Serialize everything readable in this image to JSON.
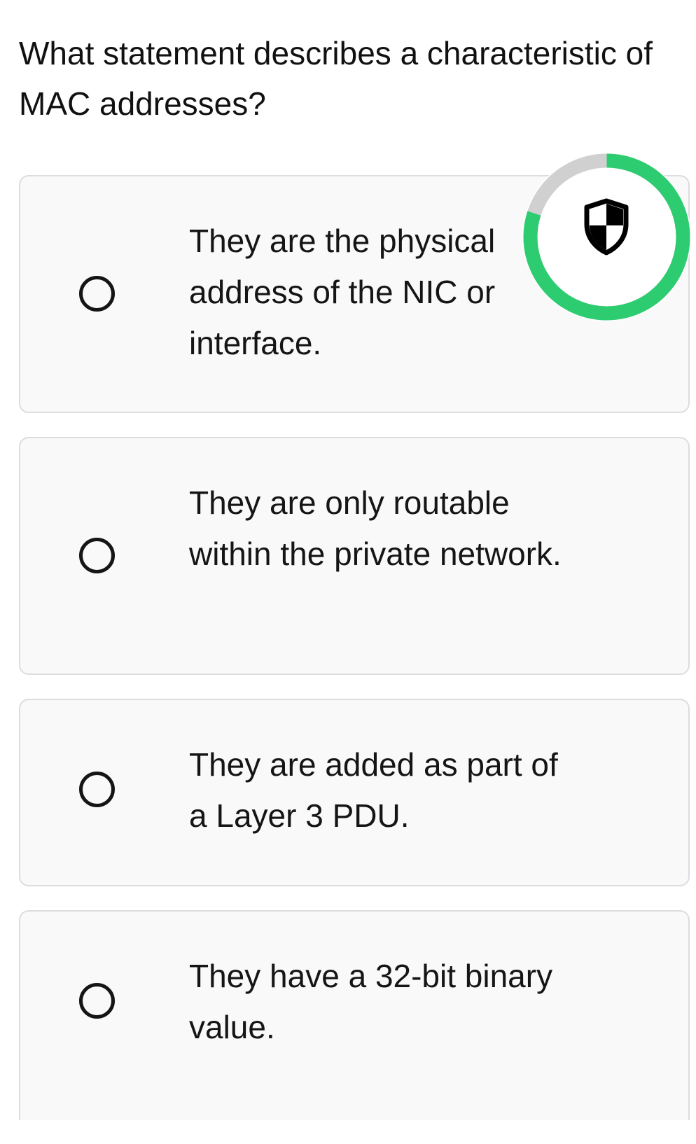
{
  "question": {
    "text": "What statement describes a characteristic of MAC addresses?"
  },
  "options": [
    {
      "text": "They are the physical address of the NIC or interface.",
      "selected": false
    },
    {
      "text": "They are only routable within the private network.",
      "selected": false
    },
    {
      "text": "They are added as part of a Layer 3 PDU.",
      "selected": false
    },
    {
      "text": "They have a 32-bit binary value.",
      "selected": false
    }
  ],
  "badge": {
    "icon": "shield-icon",
    "progress_fraction": 0.8,
    "progress_color": "#2ecc71",
    "track_color": "#d0d0d0"
  },
  "colors": {
    "text": "#111111",
    "card_background": "#f9f9fa",
    "card_border": "#dcdde0"
  }
}
